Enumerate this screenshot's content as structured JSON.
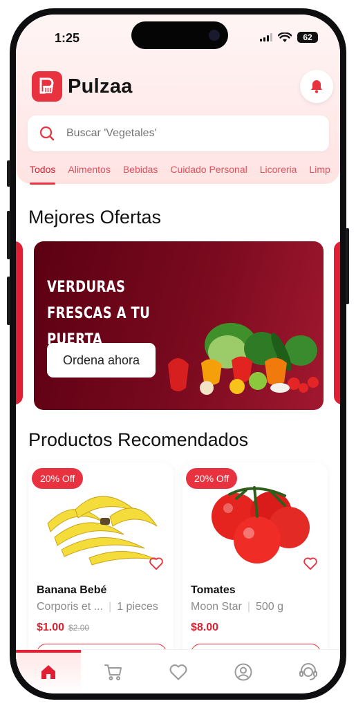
{
  "status_bar": {
    "time": "1:25",
    "battery": "62"
  },
  "header": {
    "brand": "Pulzaa",
    "logo_icon": "shopping-basket-logo-icon",
    "notification_icon": "bell-icon"
  },
  "search": {
    "placeholder": "Buscar 'Vegetales'",
    "icon": "search-icon"
  },
  "categories": [
    {
      "label": "Todos",
      "active": true
    },
    {
      "label": "Alimentos",
      "active": false
    },
    {
      "label": "Bebidas",
      "active": false
    },
    {
      "label": "Cuidado Personal",
      "active": false
    },
    {
      "label": "Licoreria",
      "active": false
    },
    {
      "label": "Limp",
      "active": false
    }
  ],
  "offers": {
    "title": "Mejores Ofertas",
    "banner": {
      "headline": "VERDURAS FRESCAS A TU PUERTA",
      "button": "Ordena ahora",
      "image": "fresh-vegetables"
    }
  },
  "recommended": {
    "title": "Productos Recomendados",
    "products": [
      {
        "badge": "20% Off",
        "name": "Banana Bebé",
        "brand": "Corporis et ...",
        "unit": "1 pieces",
        "price": "$1.00",
        "old_price": "$2.00",
        "image": "bananas"
      },
      {
        "badge": "20% Off",
        "name": "Tomates",
        "brand": "Moon Star",
        "unit": "500 g",
        "price": "$8.00",
        "old_price": "",
        "image": "tomatoes"
      }
    ]
  },
  "bottom_nav": [
    {
      "icon": "home-icon",
      "active": true
    },
    {
      "icon": "cart-icon",
      "active": false
    },
    {
      "icon": "heart-icon",
      "active": false
    },
    {
      "icon": "profile-icon",
      "active": false
    },
    {
      "icon": "support-icon",
      "active": false
    }
  ],
  "colors": {
    "accent": "#e8323f",
    "banner_dark": "#6b0618",
    "text": "#111111",
    "muted": "#8a8a8a"
  }
}
